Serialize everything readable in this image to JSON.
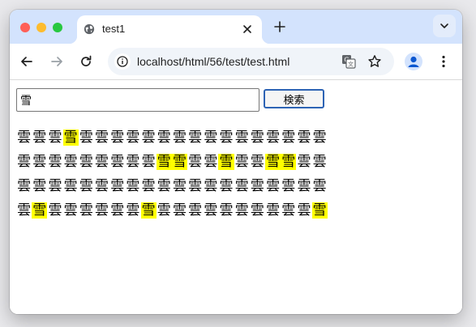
{
  "browser": {
    "tab_title": "test1",
    "url": "localhost/html/56/test/test.html"
  },
  "page": {
    "search_value": "雪",
    "search_button_label": "検索",
    "grid_rows": [
      [
        "雲",
        "雲",
        "雲",
        "雪",
        "雲",
        "雲",
        "雲",
        "雲",
        "雲",
        "雲",
        "雲",
        "雲",
        "雲",
        "雲",
        "雲",
        "雲",
        "雲",
        "雲",
        "雲",
        "雲"
      ],
      [
        "雲",
        "雲",
        "雲",
        "雲",
        "雲",
        "雲",
        "雲",
        "雲",
        "雲",
        "雪",
        "雪",
        "雲",
        "雲",
        "雪",
        "雲",
        "雲",
        "雪",
        "雪",
        "雲",
        "雲"
      ],
      [
        "雲",
        "雲",
        "雲",
        "雲",
        "雲",
        "雲",
        "雲",
        "雲",
        "雲",
        "雲",
        "雲",
        "雲",
        "雲",
        "雲",
        "雲",
        "雲",
        "雲",
        "雲",
        "雲",
        "雲"
      ],
      [
        "雲",
        "雪",
        "雲",
        "雲",
        "雲",
        "雲",
        "雲",
        "雲",
        "雪",
        "雲",
        "雲",
        "雲",
        "雲",
        "雲",
        "雲",
        "雲",
        "雲",
        "雲",
        "雲",
        "雪"
      ]
    ],
    "highlight_char": "雪",
    "highlight_color": "#ffff00"
  },
  "icons": {
    "tab_favicon": "globe-icon",
    "tab_close": "close-icon",
    "new_tab": "plus-icon",
    "tab_search": "chevron-down-icon",
    "back": "arrow-left-icon",
    "forward": "arrow-right-icon",
    "reload": "reload-icon",
    "site_info": "info-icon",
    "translate": "translate-icon",
    "bookmark": "star-icon",
    "profile": "avatar-icon",
    "menu": "kebab-menu-icon"
  }
}
